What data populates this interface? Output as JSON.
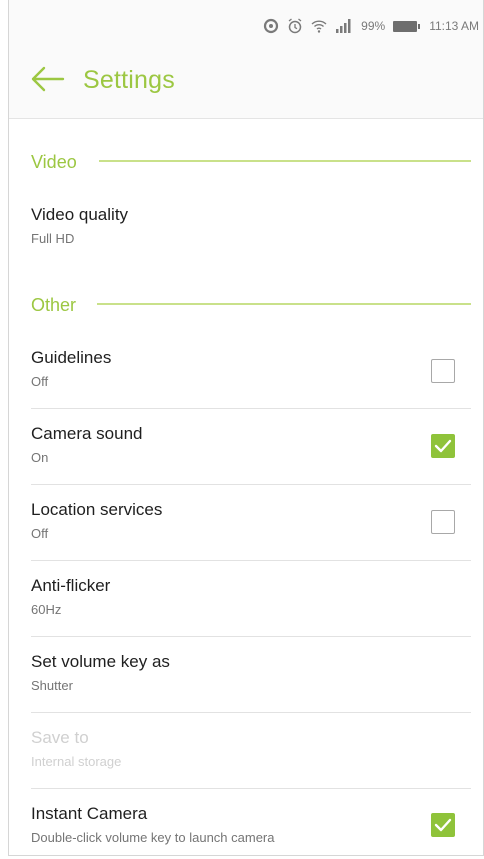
{
  "status_bar": {
    "icons": [
      "sync-icon",
      "alarm-icon",
      "wifi-icon",
      "signal-icon",
      "battery-icon"
    ],
    "battery": "99%",
    "time": "11:13 AM"
  },
  "app_bar": {
    "title": "Settings",
    "back_icon": "back-arrow-icon"
  },
  "colors": {
    "accent": "#9cc742",
    "checked": "#8fc33a",
    "section_line": "#c9e18a"
  },
  "sections": [
    {
      "title": "Video",
      "items": [
        {
          "title": "Video quality",
          "summary": "Full HD"
        }
      ]
    },
    {
      "title": "Other",
      "items": [
        {
          "title": "Guidelines",
          "summary": "Off",
          "checkbox": false
        },
        {
          "title": "Camera sound",
          "summary": "On",
          "checkbox": true
        },
        {
          "title": "Location services",
          "summary": "Off",
          "checkbox": false
        },
        {
          "title": "Anti-flicker",
          "summary": "60Hz"
        },
        {
          "title": "Set volume key as",
          "summary": "Shutter"
        },
        {
          "title": "Save to",
          "summary": "Internal storage",
          "disabled": true
        },
        {
          "title": "Instant Camera",
          "summary": "Double-click volume key to launch camera",
          "checkbox": true
        }
      ]
    }
  ]
}
